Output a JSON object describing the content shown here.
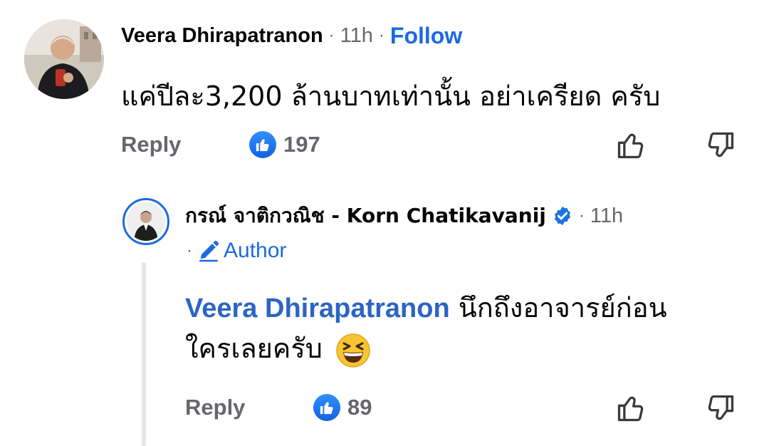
{
  "comment": {
    "author": "Veera Dhirapatranon",
    "separator": "·",
    "time": "11h",
    "follow_label": "Follow",
    "text": "แค่ปีละ3,200 ล้านบาทเท่านั้น อย่าเครียด ครับ",
    "reply_label": "Reply",
    "like_count": "197"
  },
  "reply": {
    "author": "กรณ์ จาติกวณิช - Korn Chatikavanij",
    "separator": "·",
    "time": "11h",
    "author_badge": "Author",
    "mention": "Veera Dhirapatranon",
    "text_line1": " นึกถึงอาจารย์ก่อน",
    "text_line2": "ใครเลยครับ",
    "reply_label": "Reply",
    "like_count": "89"
  },
  "icons": {
    "like": "thumbs-up-icon",
    "upvote": "thumbs-up-outline-icon",
    "downvote": "thumbs-down-outline-icon",
    "verified": "verified-badge-icon",
    "author": "pencil-icon",
    "emoji": "laughing-emoji-icon"
  },
  "colors": {
    "accent": "#1b6ae0",
    "secondary_text": "#65676b",
    "thread_line": "#e4e6eb"
  }
}
